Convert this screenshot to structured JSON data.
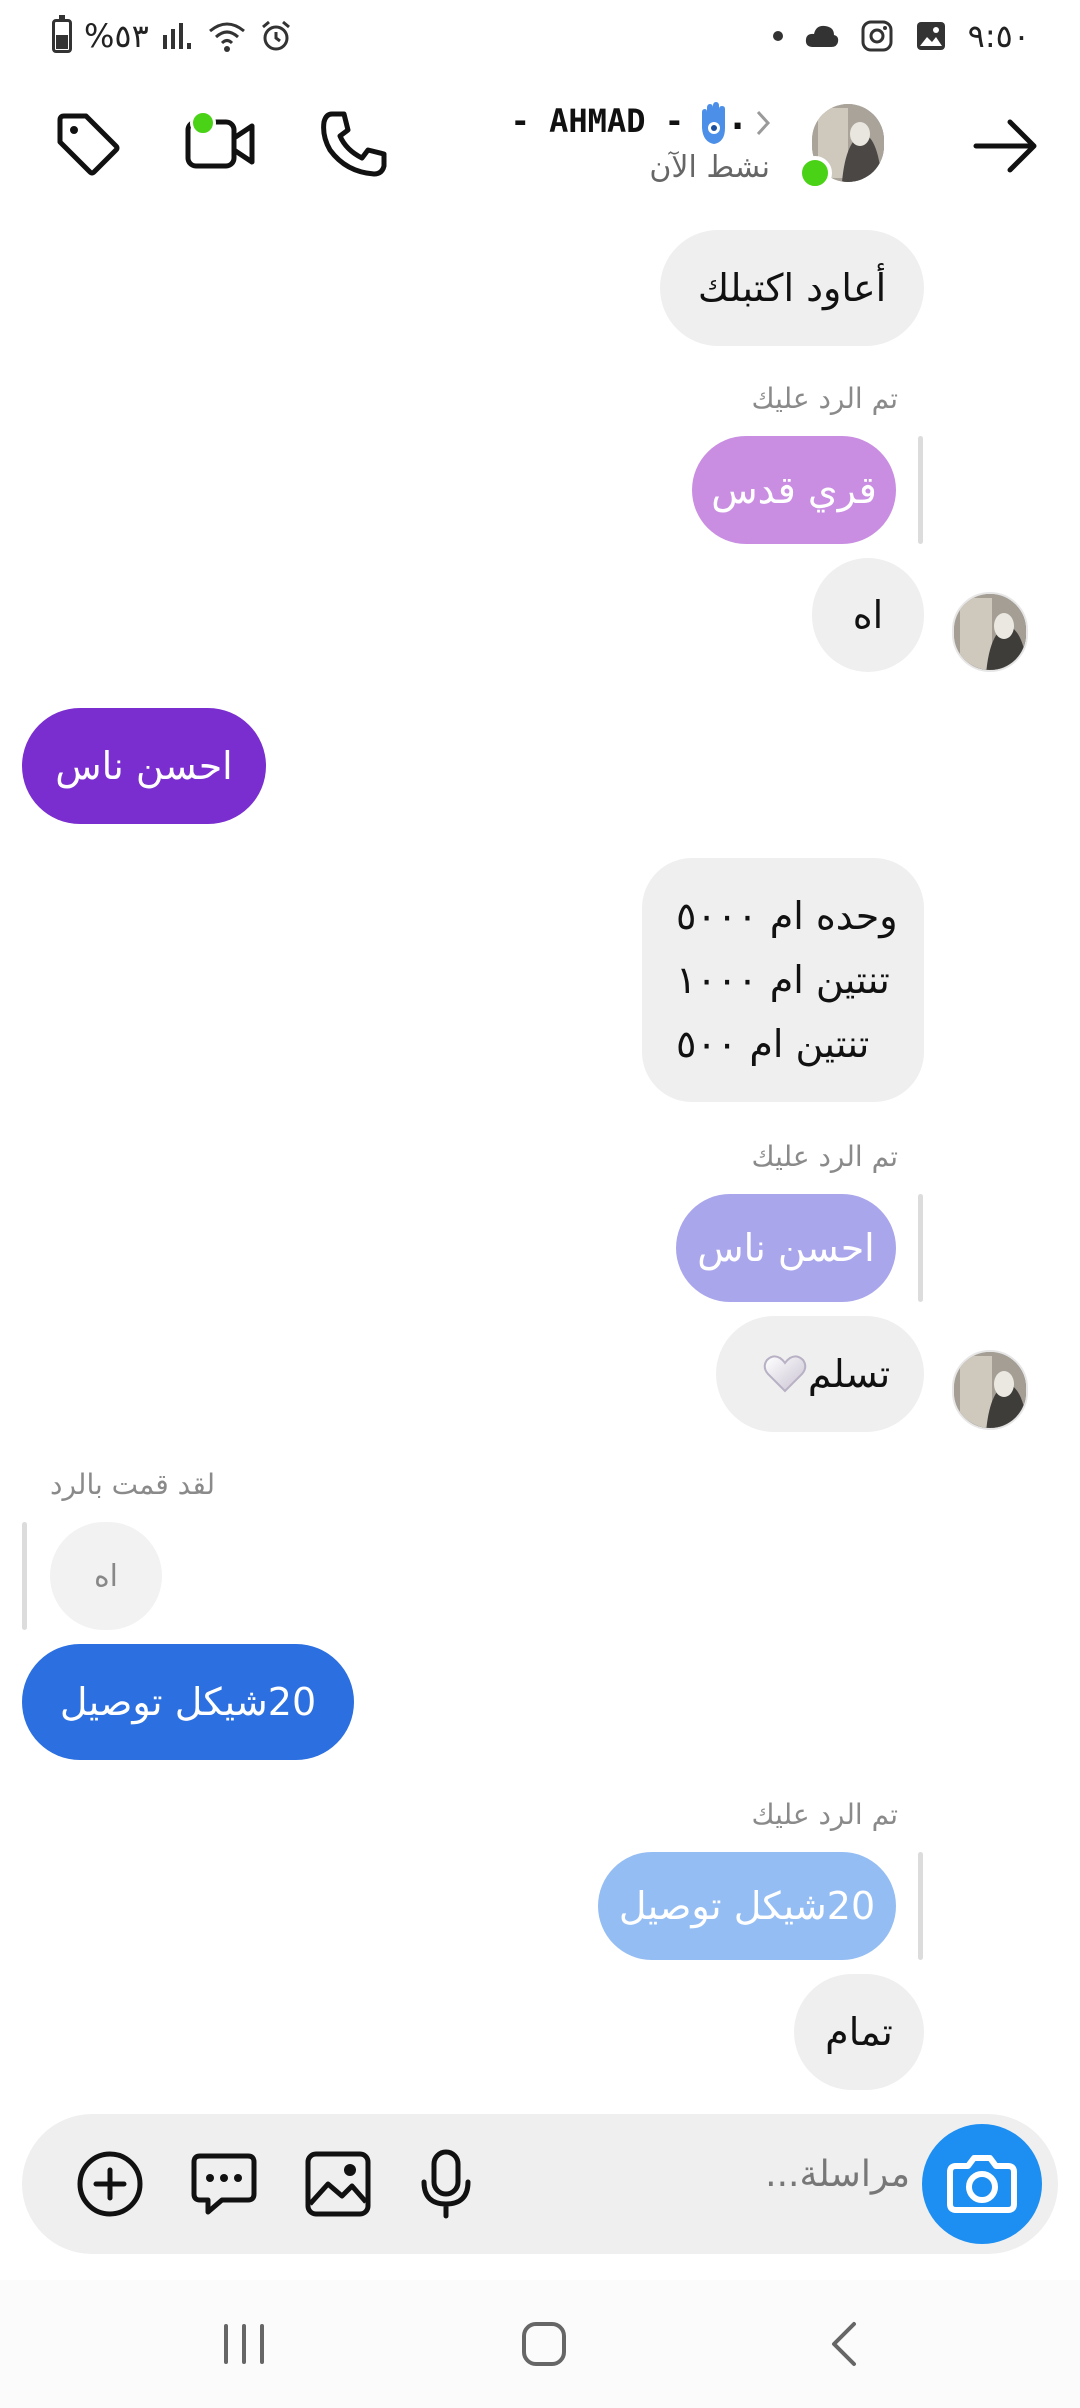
{
  "status_bar": {
    "time": "٩:٥٠",
    "battery_text": "%٥٣",
    "icons": [
      "battery-icon",
      "signal-icon",
      "wifi-icon",
      "alarm-icon",
      "dot-icon",
      "cloud-icon",
      "instagram-icon",
      "gallery-icon"
    ]
  },
  "header": {
    "contact_name": "- AHMAD -",
    "name_suffix": ".",
    "active_status": "نشط الآن",
    "icons": [
      "tag-icon",
      "video-call-icon",
      "phone-call-icon",
      "back-arrow-icon",
      "hamsa-icon"
    ],
    "online_color": "#4ad216"
  },
  "messages": {
    "m1": "أعاود اكتبلك",
    "reply1_label": "تم الرد عليك",
    "reply1_quote": "قري قدس",
    "m2": "اه",
    "m3": "احسن ناس",
    "m4_lines": [
      "وحده ام ٥٠٠٠",
      "تنتين ام ١٠٠٠",
      "تنتين ام ٥٠٠"
    ],
    "reply2_label": "تم الرد عليك",
    "reply2_quote": "احسن ناس",
    "m5": "تسلم",
    "reply3_label": "لقد قمت بالرد",
    "reply3_quote": "اه",
    "m6": "20شيكل توصيل",
    "reply4_label": "تم الرد عليك",
    "reply4_quote": "20شيكل توصيل",
    "m7": "تمام"
  },
  "colors": {
    "outgoing_purple": "#7a2ecf",
    "outgoing_blue": "#2b6fe0",
    "quote_lavender": "#c98ee2",
    "quote_periwinkle": "#a9a6ec",
    "quote_light_blue": "#94bdf4",
    "incoming_gray": "#efefef",
    "camera_blue": "#1d8ff2"
  },
  "composer": {
    "placeholder": "مراسلة...",
    "icons": [
      "camera-icon",
      "microphone-icon",
      "image-icon",
      "sticker-icon",
      "add-icon"
    ]
  },
  "navbar": {
    "icons": [
      "recent-apps-icon",
      "home-icon",
      "back-icon"
    ]
  }
}
